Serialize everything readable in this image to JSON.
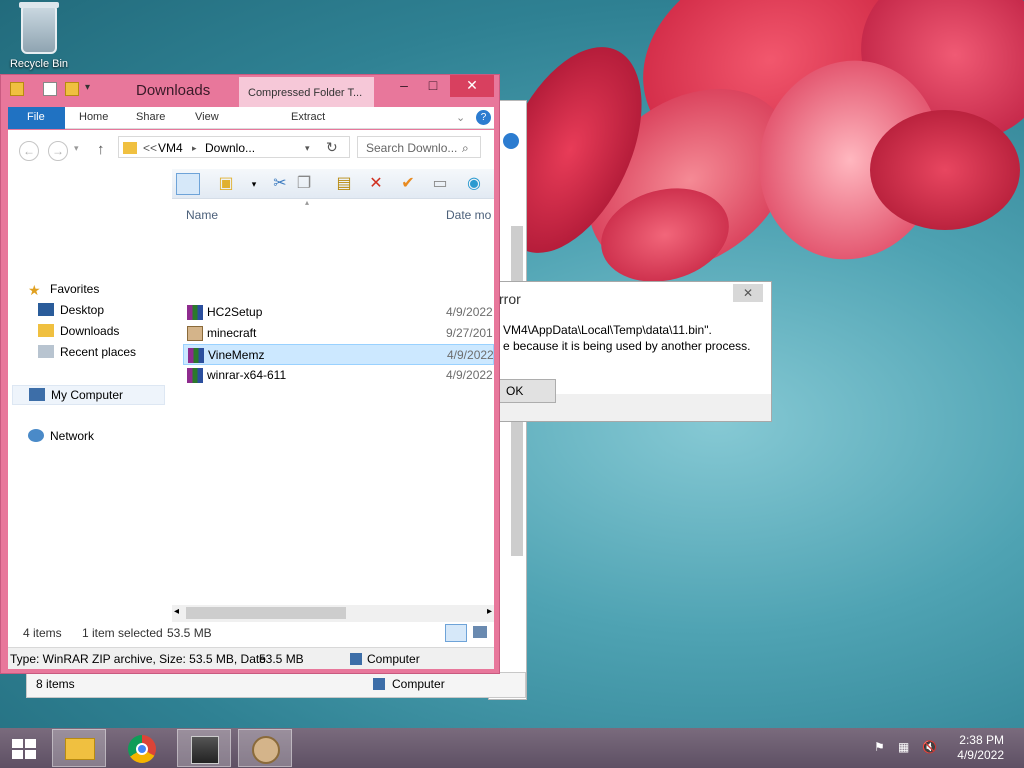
{
  "desktop": {
    "recycle_bin_label": "Recycle Bin"
  },
  "explorer": {
    "title": "Downloads",
    "context_tab": "Compressed Folder T...",
    "ribbon_tabs": [
      "Home",
      "Share",
      "View"
    ],
    "file_tab": "File",
    "extract_tab": "Extract",
    "address": {
      "chevrons": "<<",
      "segment1": "VM4",
      "segment2": "Downlo..."
    },
    "search_placeholder": "Search Downlo...",
    "columns": {
      "name": "Name",
      "date": "Date mo"
    },
    "nav": {
      "favorites": "Favorites",
      "desktop": "Desktop",
      "downloads": "Downloads",
      "recent": "Recent places",
      "my_computer": "My Computer",
      "network": "Network"
    },
    "files": [
      {
        "name": "HC2Setup",
        "date": "4/9/2022",
        "icon": "winrar-archive-icon"
      },
      {
        "name": "minecraft",
        "date": "9/27/201",
        "icon": "installer-icon"
      },
      {
        "name": "VineMemz",
        "date": "4/9/2022",
        "icon": "winrar-archive-icon",
        "selected": true
      },
      {
        "name": "winrar-x64-611",
        "date": "4/9/2022",
        "icon": "winrar-archive-icon"
      }
    ],
    "status": {
      "items": "4 items",
      "selected": "1 item selected",
      "size": "53.5 MB"
    },
    "details": {
      "type_info": "Type: WinRAR ZIP archive, Size: 53.5 MB, Date",
      "size": "53.5 MB",
      "location": "Computer"
    }
  },
  "back_window": {
    "items": "8 items",
    "location": "Computer"
  },
  "error_dialog": {
    "title": "rror",
    "line1": "VM4\\AppData\\Local\\Temp\\data\\11.bin\".",
    "line2": "e because it is being used by another process.",
    "ok_label": "OK"
  },
  "taskbar": {
    "time": "2:38 PM",
    "date": "4/9/2022"
  },
  "colors": {
    "window_frame": "#e8779b",
    "file_tab": "#2072c2",
    "selection": "#cce8ff",
    "close_button": "#d8405f"
  }
}
